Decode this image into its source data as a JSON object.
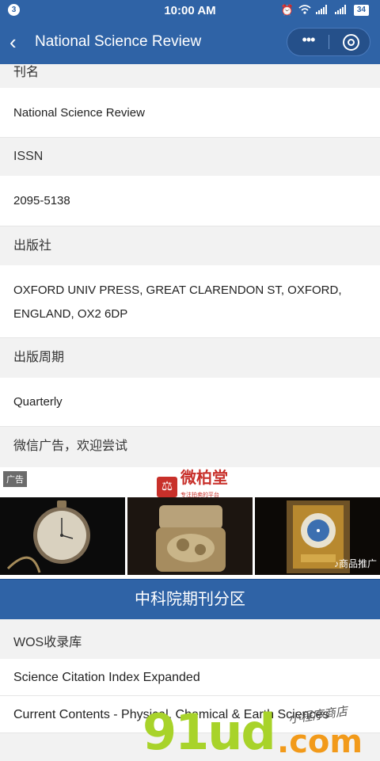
{
  "status_bar": {
    "notification_count": "3",
    "time": "10:00 AM",
    "battery": "34"
  },
  "nav": {
    "title": "National Science Review",
    "more_glyph": "•••"
  },
  "fields": [
    {
      "label": "刊名",
      "value": "National Science Review"
    },
    {
      "label": "ISSN",
      "value": "2095-5138"
    },
    {
      "label": "出版社",
      "value_lines": [
        "OXFORD UNIV PRESS, GREAT CLARENDON ST, OXFORD,",
        "ENGLAND, OX2 6DP"
      ]
    },
    {
      "label": "出版周期",
      "value": "Quarterly"
    }
  ],
  "ad": {
    "section_label": "微信广告，欢迎尝试",
    "tag": "广告",
    "brand": "微柏堂",
    "brand_slogan": "专注拍卖的平台",
    "promo": "♪商品推广"
  },
  "banner": {
    "label": "中科院期刊分区"
  },
  "wos": {
    "label": "WOS收录库",
    "items": [
      "Science Citation Index Expanded",
      "Current Contents - Physical, Chemical & Earth Sciences"
    ]
  },
  "watermark": {
    "big": "91ud",
    "com": ".com",
    "cn": "小程序商店"
  },
  "colors": {
    "primary": "#2f63a6",
    "ad_red": "#c8302a"
  }
}
